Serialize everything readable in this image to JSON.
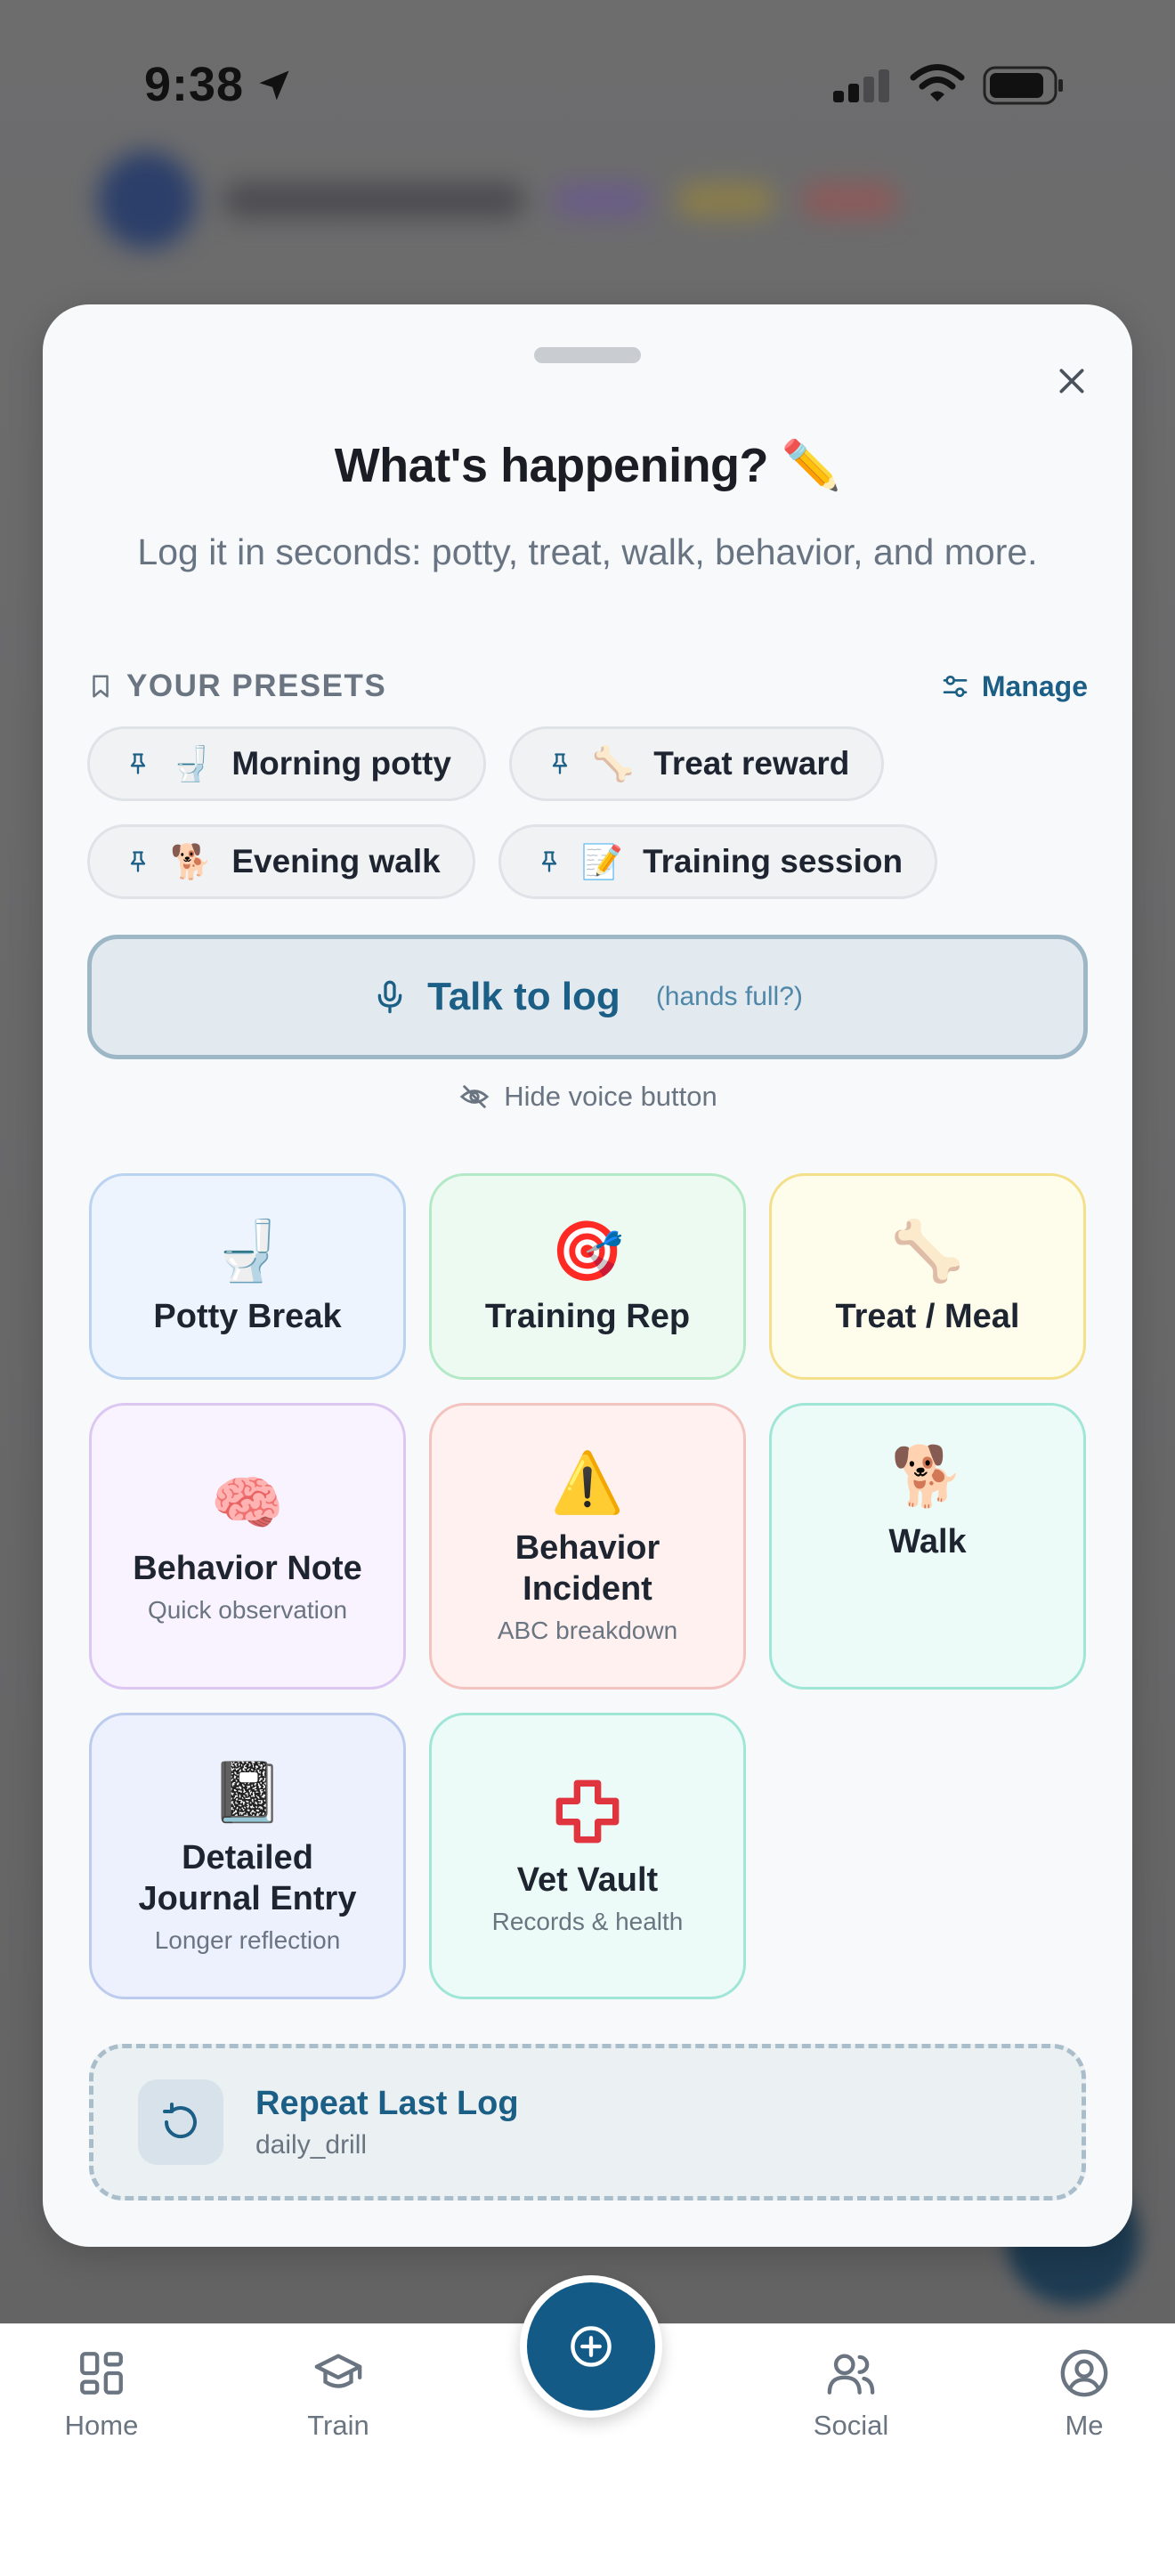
{
  "status_bar": {
    "time": "9:38"
  },
  "sheet": {
    "title": "What's happening? ✏️",
    "subtitle": "Log it in seconds: potty, treat, walk, behavior, and more.",
    "presets": {
      "header": "YOUR PRESETS",
      "manage_label": "Manage",
      "items": [
        {
          "emoji": "🚽",
          "label": "Morning potty"
        },
        {
          "emoji": "🦴",
          "label": "Treat reward"
        },
        {
          "emoji": "🐕",
          "label": "Evening walk"
        },
        {
          "emoji": "📝",
          "label": "Training session"
        }
      ]
    },
    "talk": {
      "label": "Talk to log",
      "hint": "(hands full?)"
    },
    "hide_voice_label": "Hide voice button",
    "tiles": [
      {
        "emoji": "🚽",
        "label": "Potty Break",
        "sub": ""
      },
      {
        "emoji": "🎯",
        "label": "Training Rep",
        "sub": ""
      },
      {
        "emoji": "🦴",
        "label": "Treat / Meal",
        "sub": ""
      },
      {
        "emoji": "🧠",
        "label": "Behavior Note",
        "sub": "Quick observation"
      },
      {
        "emoji": "⚠️",
        "label": "Behavior Incident",
        "sub": "ABC breakdown"
      },
      {
        "emoji": "🐕",
        "label": "Walk",
        "sub": ""
      },
      {
        "emoji": "📓",
        "label": "Detailed Journal Entry",
        "sub": "Longer reflection"
      },
      {
        "emoji": "✚",
        "label": "Vet Vault",
        "sub": "Records & health"
      }
    ],
    "repeat": {
      "title": "Repeat Last Log",
      "sub": "daily_drill"
    }
  },
  "tab_bar": {
    "tabs": [
      {
        "label": "Home",
        "icon": "grid-icon"
      },
      {
        "label": "Train",
        "icon": "graduation-cap-icon"
      },
      {
        "label": "Social",
        "icon": "users-icon"
      },
      {
        "label": "Me",
        "icon": "user-circle-icon"
      }
    ],
    "fab_icon": "plus-circle-icon"
  },
  "colors": {
    "accent": "#135b86",
    "potty": "#eef4fd",
    "training": "#edfaf1",
    "treat": "#fefcea",
    "behavior_note": "#f8f3fe",
    "incident": "#fef1f0",
    "walk": "#ecfbf7",
    "journal": "#edf1fd",
    "vet": "#ecfbf7"
  }
}
